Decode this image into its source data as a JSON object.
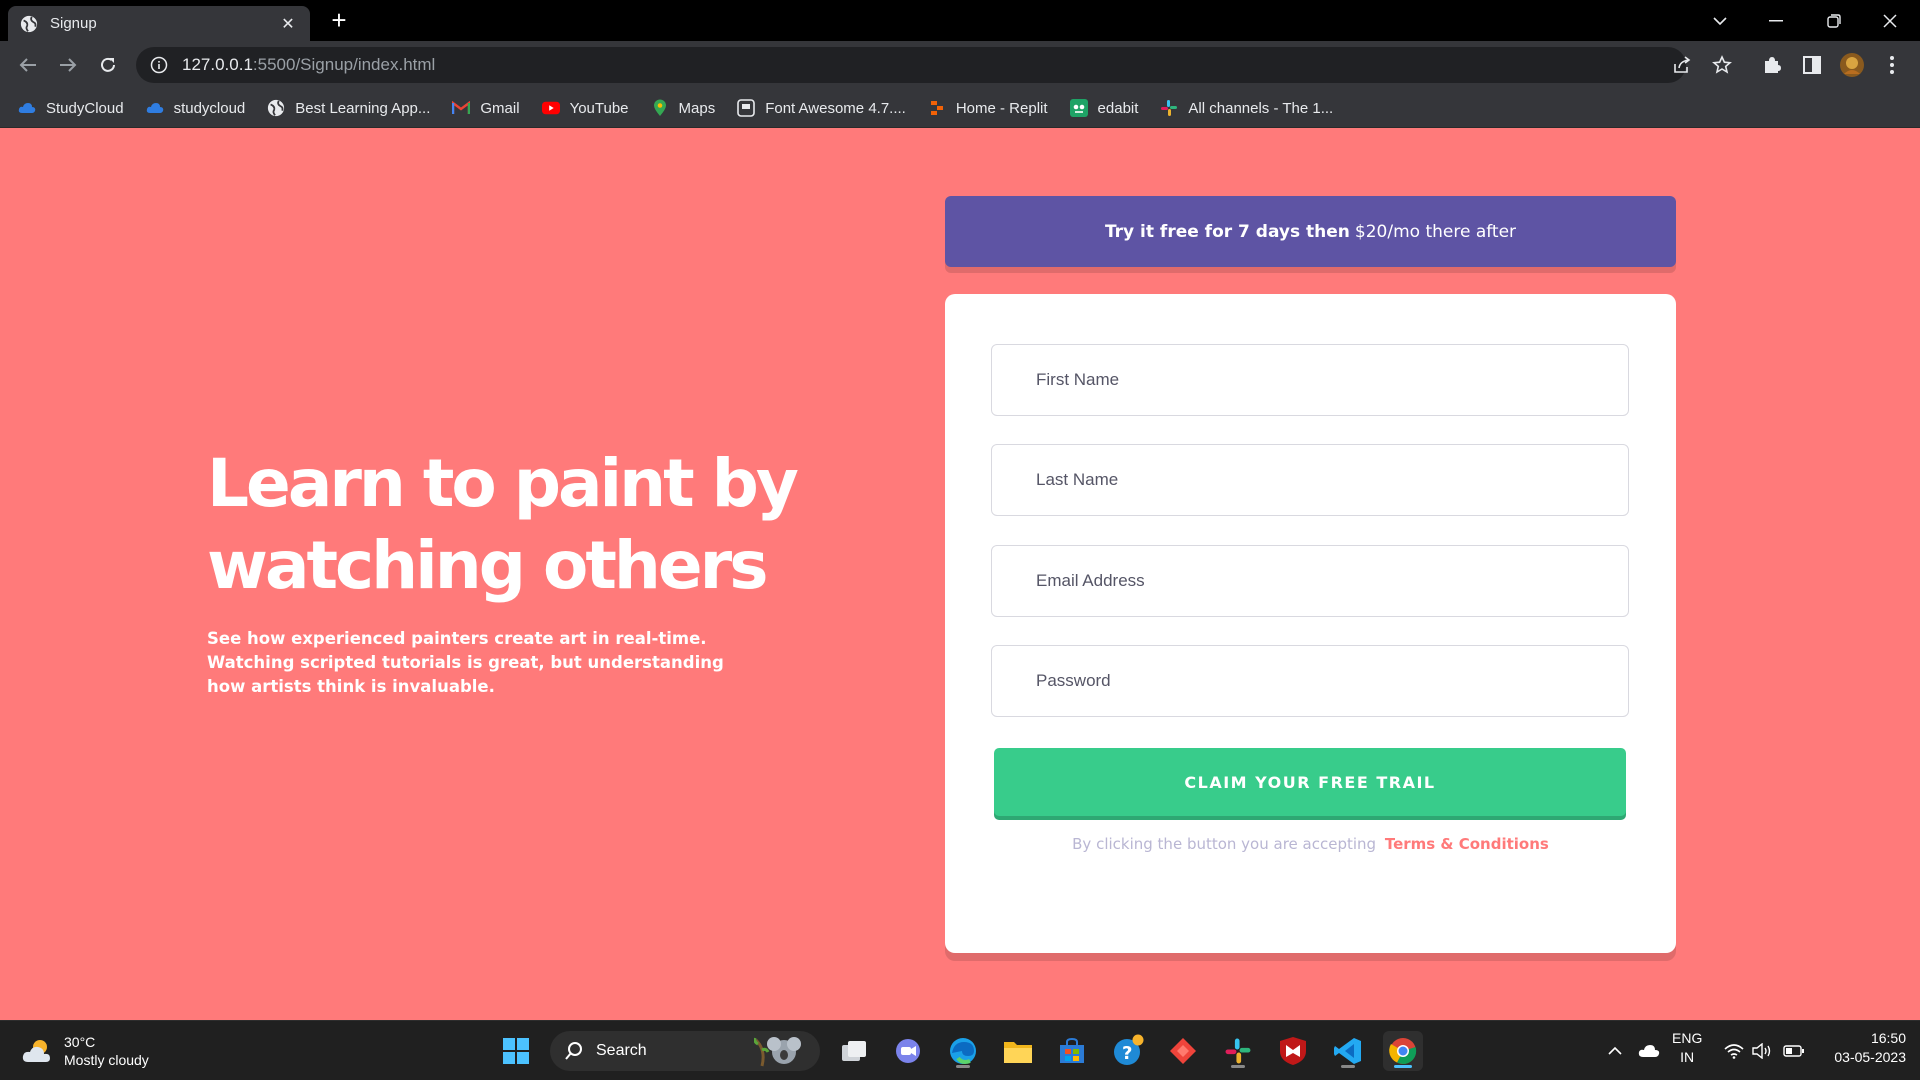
{
  "browser": {
    "tab_title": "Signup",
    "url_host": "127.0.0.1",
    "url_path": ":5500/Signup/index.html",
    "bookmarks": [
      {
        "label": "StudyCloud",
        "icon": "cloud-icon"
      },
      {
        "label": "studycloud",
        "icon": "cloud-icon"
      },
      {
        "label": "Best Learning App...",
        "icon": "globe-icon"
      },
      {
        "label": "Gmail",
        "icon": "gmail-icon"
      },
      {
        "label": "YouTube",
        "icon": "youtube-icon"
      },
      {
        "label": "Maps",
        "icon": "maps-pin-icon"
      },
      {
        "label": "Font Awesome 4.7....",
        "icon": "font-awesome-icon"
      },
      {
        "label": "Home - Replit",
        "icon": "replit-icon"
      },
      {
        "label": "edabit",
        "icon": "edabit-icon"
      },
      {
        "label": "All channels - The 1...",
        "icon": "slack-icon"
      }
    ]
  },
  "hero": {
    "title": "Learn to paint by watching others",
    "description": "See how experienced painters create art in real-time. Watching scripted tutorials is great, but understanding how artists think is invaluable."
  },
  "promo": {
    "bold": "Try it free for 7 days then",
    "rest": "$20/mo there after"
  },
  "form": {
    "first_name_placeholder": "First Name",
    "last_name_placeholder": "Last Name",
    "email_placeholder": "Email Address",
    "password_placeholder": "Password",
    "submit_label": "CLAIM YOUR FREE TRAIL",
    "terms_prefix": "By clicking the button you are accepting",
    "terms_link": "Terms & Conditions"
  },
  "taskbar": {
    "temperature": "30°C",
    "weather": "Mostly cloudy",
    "search_label": "Search",
    "language": "ENG",
    "region": "IN",
    "time": "16:50",
    "date": "03-05-2023"
  },
  "colors": {
    "background": "#ff7a7a",
    "promo": "#5e54a4",
    "cta": "#38cc8b"
  }
}
